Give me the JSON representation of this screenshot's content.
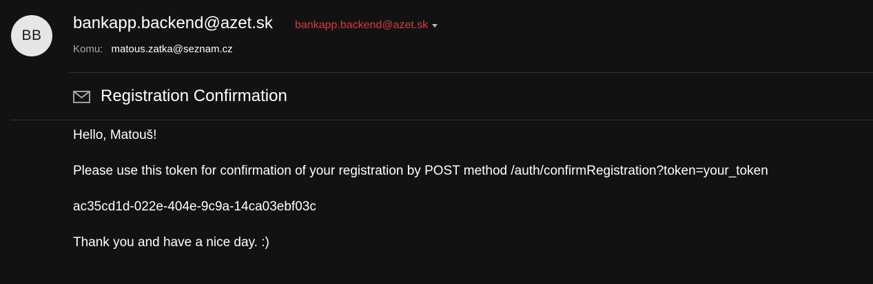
{
  "sender": {
    "initials": "BB",
    "name": "bankapp.backend@azet.sk",
    "email": "bankapp.backend@azet.sk"
  },
  "recipient": {
    "label": "Komu:",
    "value": "matous.zatka@seznam.cz"
  },
  "subject": "Registration Confirmation",
  "body": {
    "lines": [
      "Hello, Matouš!",
      "Please use this token for confirmation of your registration by POST method /auth/confirmRegistration?token=your_token",
      "ac35cd1d-022e-404e-9c9a-14ca03ebf03c",
      "Thank you and have a nice day. :)"
    ]
  },
  "colors": {
    "background": "#121212",
    "sender_email": "#d93b3b",
    "avatar_bg": "#e6e6e6"
  },
  "icons": {
    "envelope": "envelope-icon",
    "dropdown": "chevron-down-icon"
  }
}
